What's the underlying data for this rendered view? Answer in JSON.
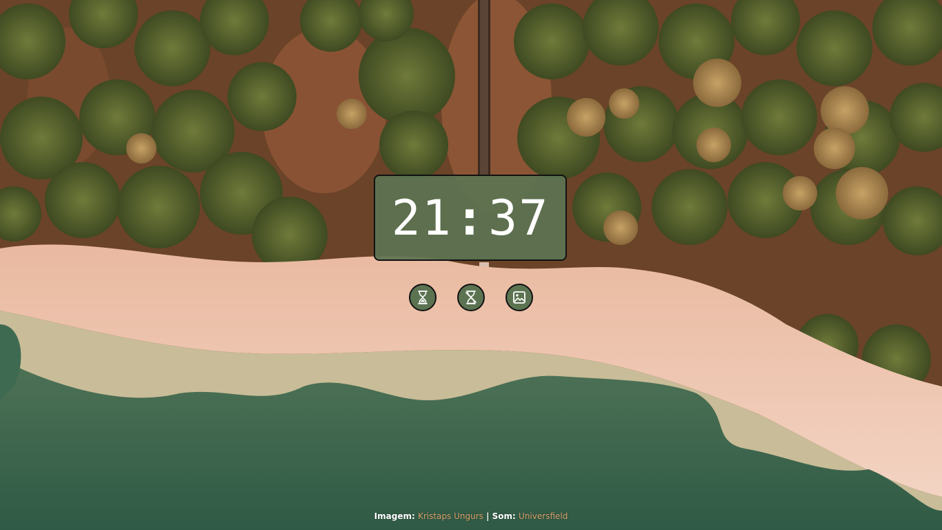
{
  "clock": {
    "hours": "21",
    "separator": ":",
    "minutes": "37"
  },
  "controls": {
    "buttons": [
      {
        "icon": "hourglass-icon"
      },
      {
        "icon": "hourglass-crossed-icon"
      },
      {
        "icon": "image-icon"
      }
    ]
  },
  "credits": {
    "image_label": "Imagem:",
    "image_author": "Kristaps Ungurs",
    "divider": "|",
    "sound_label": "Som:",
    "sound_author": "Universfield"
  },
  "colors": {
    "panel": "#5c7352",
    "link": "#d9a06a",
    "text": "#ffffff"
  }
}
